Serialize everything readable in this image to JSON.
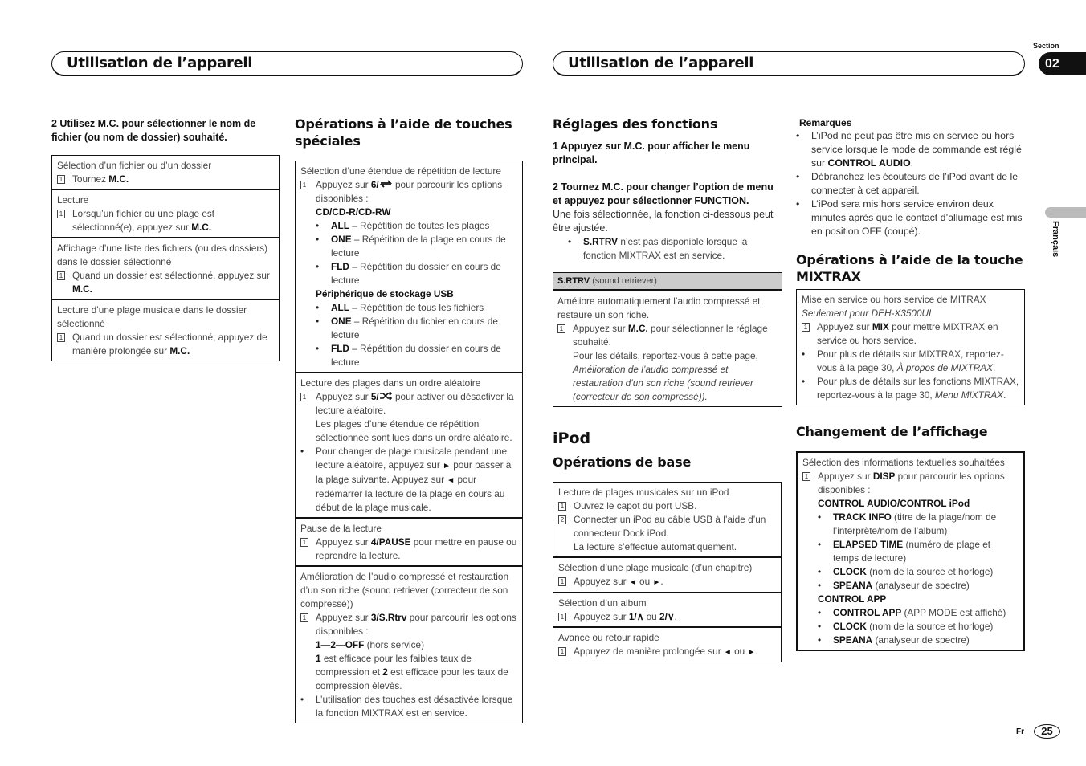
{
  "header": {
    "left_title": "Utilisation de l’appareil",
    "right_title": "Utilisation de l’appareil",
    "section_label": "Section",
    "section_number": "02",
    "language": "Français"
  },
  "footer": {
    "lang_code": "Fr",
    "page_number": "25"
  },
  "col1": {
    "step2": "2    Utilisez M.C. pour sélectionner le nom de fichier (ou nom de dossier) souhaité.",
    "cells": [
      {
        "title": "Sélection d’un fichier ou d’un dossier",
        "num": "1",
        "text": "Tournez ",
        "bold": "M.C."
      },
      {
        "title": "Lecture",
        "num": "1",
        "text": "Lorsqu’un fichier ou une plage est sélectionné(e), appuyez sur ",
        "bold": "M.C."
      },
      {
        "title": "Affichage d’une liste des fichiers (ou des dossiers) dans le dossier sélectionné",
        "num": "1",
        "text": "Quand un dossier est sélectionné, appuyez sur ",
        "bold": "M.C."
      },
      {
        "title": "Lecture d’une plage musicale dans le dossier sélectionné",
        "num": "1",
        "text": "Quand un dossier est sélectionné, appuyez de manière prolongée sur ",
        "bold": "M.C."
      }
    ]
  },
  "col2": {
    "heading": "Opérations à l’aide de touches spéciales",
    "repeat": {
      "title": "Sélection d’une étendue de répétition de lecture",
      "num": "1",
      "pre": "Appuyez sur ",
      "key": "6/",
      "post": " pour parcourir les options disponibles :",
      "groups": [
        {
          "name": "CD/CD-R/CD-RW",
          "items": [
            {
              "key": "ALL",
              "desc": " – Répétition de toutes les plages"
            },
            {
              "key": "ONE",
              "desc": " – Répétition de la plage en cours de lecture"
            },
            {
              "key": "FLD",
              "desc": " – Répétition du dossier en cours de lecture"
            }
          ]
        },
        {
          "name": "Périphérique de stockage USB",
          "items": [
            {
              "key": "ALL",
              "desc": " – Répétition de tous les fichiers"
            },
            {
              "key": "ONE",
              "desc": " – Répétition du fichier en cours de lecture"
            },
            {
              "key": "FLD",
              "desc": " – Répétition du dossier en cours de lecture"
            }
          ]
        }
      ]
    },
    "random": {
      "title": "Lecture des plages dans un ordre aléatoire",
      "num": "1",
      "pre": "Appuyez sur ",
      "key": "5/",
      "post": " pour activer ou désactiver la lecture aléatoire.",
      "note": "Les plages d’une étendue de répétition sélectionnée sont lues dans un ordre aléatoire.",
      "bullet_a": "Pour changer de plage musicale pendant une lecture aléatoire, appuyez sur ",
      "bullet_b": " pour passer à la plage suivante. Appuyez sur ",
      "bullet_c": " pour redémarrer la lecture de la plage en cours au début de la plage musicale."
    },
    "pause": {
      "title": "Pause de la lecture",
      "num": "1",
      "pre": "Appuyez sur ",
      "key": "4/PAUSE",
      "post": " pour mettre en pause ou reprendre la lecture."
    },
    "sound": {
      "title": "Amélioration de l’audio compressé et restauration d’un son riche (sound retriever (correcteur de son compressé))",
      "num": "1",
      "pre": "Appuyez sur ",
      "key": "3/S.Rtrv",
      "post": " pour parcourir les options disponibles :",
      "options_bold": "1—2—OFF",
      "options_rest": " (hors service)",
      "expl_1": "1",
      "expl_a": " est efficace pour les faibles taux de compression et ",
      "expl_2": "2",
      "expl_b": " est efficace pour les taux de compression élevés.",
      "bullet": "L’utilisation des touches est désactivée lorsque la fonction MIXTRAX est en service."
    }
  },
  "col3": {
    "heading": "Réglages des fonctions",
    "step1": "1    Appuyez sur M.C. pour afficher le menu principal.",
    "step2": "2    Tournez M.C. pour changer l’option de menu et appuyez pour sélectionner FUNCTION.",
    "step2_body": "Une fois sélectionnée, la fonction ci-dessous peut être ajustée.",
    "srtrv_note_bold": "S.RTRV",
    "srtrv_note": " n’est pas disponible lorsque la fonction MIXTRAX est en service.",
    "srtrv_head_bold": "S.RTRV",
    "srtrv_head": " (sound retriever)",
    "srtrv_desc": "Améliore automatiquement l’audio compressé et restaure un son riche.",
    "srtrv_num": "1",
    "srtrv_pre": "Appuyez sur ",
    "srtrv_key": "M.C.",
    "srtrv_post": " pour sélectionner le réglage souhaité.",
    "srtrv_ref": "Pour les détails, reportez-vous à cette page, ",
    "srtrv_ref_italic": "Amélioration de l’audio compressé et restauration d’un son riche (sound retriever (correcteur de son compressé)).",
    "ipod_heading": "iPod",
    "basic_heading": "Opérations de base",
    "basic": {
      "play_title": "Lecture de plages musicales sur un iPod",
      "step1": "Ouvrez le capot du port USB.",
      "step2": "Connecter un iPod au câble USB à l’aide d’un connecteur Dock iPod.",
      "step2_note": "La lecture s’effectue automatiquement.",
      "track_title": "Sélection d’une plage musicale (d’un chapitre)",
      "track_pre": "Appuyez sur ",
      "track_mid": " ou ",
      "album_title": "Sélection d’un album",
      "album_pre": "Appuyez sur ",
      "album_k1": "1/",
      "album_mid": " ou ",
      "album_k2": "2/",
      "ff_title": "Avance ou retour rapide",
      "ff_pre": "Appuyez de manière prolongée sur ",
      "ff_mid": " ou "
    }
  },
  "col4": {
    "remarks_heading": "Remarques",
    "remarks": [
      {
        "text": "L’iPod ne peut pas être mis en service ou hors service lorsque le mode de commande est réglé sur ",
        "bold": "CONTROL AUDIO",
        "tail": "."
      },
      {
        "text": "Débranchez les écouteurs de l’iPod avant de le connecter à cet appareil.",
        "bold": "",
        "tail": ""
      },
      {
        "text": "L’iPod sera mis hors service environ deux minutes après que le contact d’allumage est mis en position OFF (coupé).",
        "bold": "",
        "tail": ""
      }
    ],
    "mixtrax_heading": "Opérations à l’aide de la touche MIXTRAX",
    "mixtrax": {
      "title": "Mise en service ou hors service de MITRAX",
      "subtitle": "Seulement pour DEH-X3500UI",
      "num": "1",
      "pre": "Appuyez sur ",
      "key": "MIX",
      "post": " pour mettre MIXTRAX en service ou hors service.",
      "b1_pre": "Pour plus de détails sur MIXTRAX, reportez-vous à la page 30, ",
      "b1_italic": "À propos de MIXTRAX",
      "b2_pre": "Pour plus de détails sur les fonctions MIXTRAX, reportez-vous à la page 30, ",
      "b2_italic": "Menu MIXTRAX"
    },
    "display_heading": "Changement de l’affichage",
    "display": {
      "title": "Sélection des informations textuelles souhaitées",
      "num": "1",
      "pre": "Appuyez sur ",
      "key": "DISP",
      "post": " pour parcourir les options disponibles :",
      "groups": [
        {
          "name": "CONTROL AUDIO/CONTROL iPod",
          "items": [
            {
              "key": "TRACK INFO",
              "desc": " (titre de la plage/nom de l’interprète/nom de l’album)"
            },
            {
              "key": "ELAPSED TIME",
              "desc": " (numéro de plage et temps de lecture)"
            },
            {
              "key": "CLOCK",
              "desc": " (nom de la source et horloge)"
            },
            {
              "key": "SPEANA",
              "desc": " (analyseur de spectre)"
            }
          ]
        },
        {
          "name": "CONTROL APP",
          "items": [
            {
              "key": "CONTROL APP",
              "desc": " (APP MODE est affiché)"
            },
            {
              "key": "CLOCK",
              "desc": " (nom de la source et horloge)"
            },
            {
              "key": "SPEANA",
              "desc": " (analyseur de spectre)"
            }
          ]
        }
      ]
    }
  }
}
